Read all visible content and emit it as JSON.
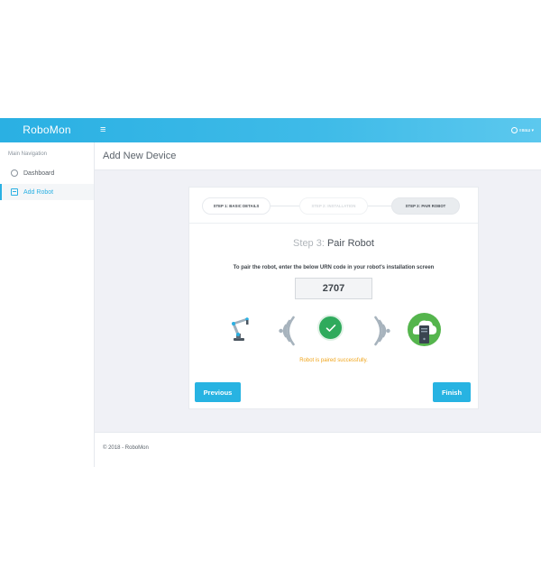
{
  "app": {
    "brand": "RoboMon",
    "menu_toggle_glyph": "≡",
    "user_label": "≡ваш ▾"
  },
  "sidebar": {
    "heading": "Main Navigation",
    "items": [
      {
        "label": "Dashboard",
        "icon": "dashboard-icon",
        "active": false
      },
      {
        "label": "Add Robot",
        "icon": "robot-icon",
        "active": true
      }
    ]
  },
  "page": {
    "title": "Add New Device"
  },
  "wizard": {
    "steps": [
      {
        "label": "STEP 1: BASIC DETAILS",
        "state": "done"
      },
      {
        "label": "STEP 2: INSTALLATION",
        "state": "faded"
      },
      {
        "label": "STEP 3: PAIR ROBOT",
        "state": "current"
      }
    ],
    "step_number": "Step 3:",
    "step_name": "Pair Robot",
    "instruction": "To pair the robot, enter the below URN code in your robot's installation screen",
    "urn_code": "2707",
    "status_message": "Robot is paired successfully.",
    "status_color": "#f0a51c",
    "success_color": "#2faa5c",
    "cloud_color": "#55b54d",
    "previous_label": "Previous",
    "finish_label": "Finish"
  },
  "footer": {
    "text": "© 2018 - RoboMon"
  },
  "colors": {
    "accent": "#2ab0e3",
    "content_bg": "#f0f1f6"
  }
}
